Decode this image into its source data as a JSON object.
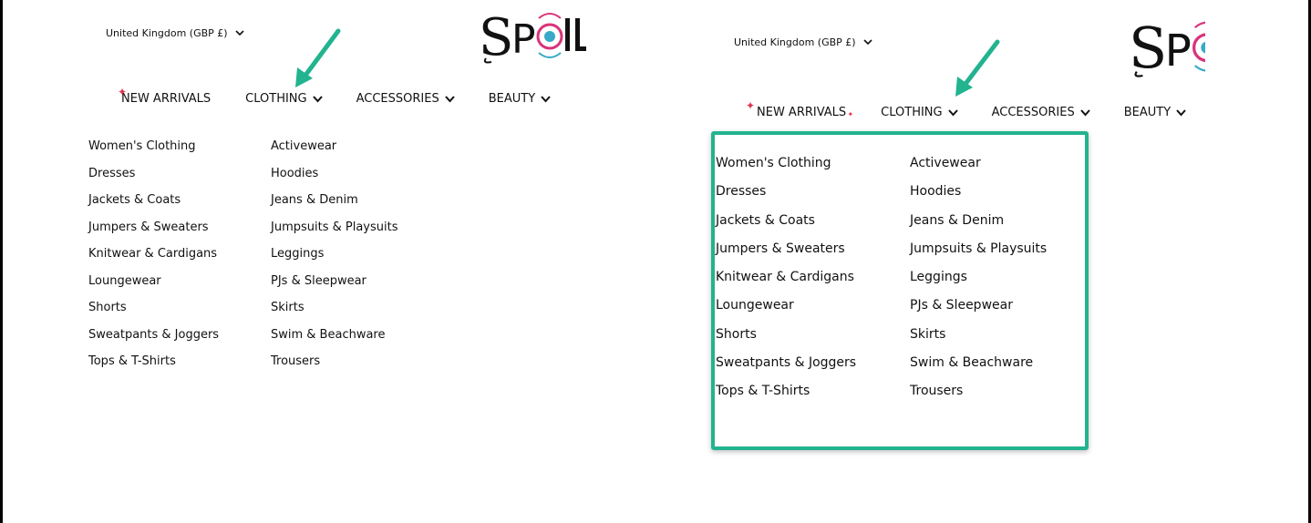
{
  "country_selector": {
    "label": "United Kingdom (GBP £)"
  },
  "logo": {
    "text": "SPOIL"
  },
  "nav": {
    "new_arrivals": "NEW ARRIVALS",
    "clothing": "CLOTHING",
    "accessories": "ACCESSORIES",
    "beauty": "BEAUTY"
  },
  "menu": {
    "col1": [
      "Women's Clothing",
      "Dresses",
      "Jackets & Coats",
      "Jumpers & Sweaters",
      "Knitwear & Cardigans",
      "Loungewear",
      "Shorts",
      "Sweatpants & Joggers",
      "Tops & T-Shirts"
    ],
    "col2": [
      "Activewear",
      "Hoodies",
      "Jeans & Denim",
      "Jumpsuits & Playsuits",
      "Leggings",
      "PJs & Sleepwear",
      "Skirts",
      "Swim & Beachware",
      "Trousers"
    ]
  },
  "colors": {
    "accent_green": "#22b38f",
    "logo_pink": "#d9337a",
    "logo_teal": "#38a9c7",
    "spark_red": "#e0344f"
  },
  "icons": {
    "dropdown": "chevron-down-icon",
    "pointer": "arrow-icon",
    "sparkle": "sparkle-icon"
  }
}
